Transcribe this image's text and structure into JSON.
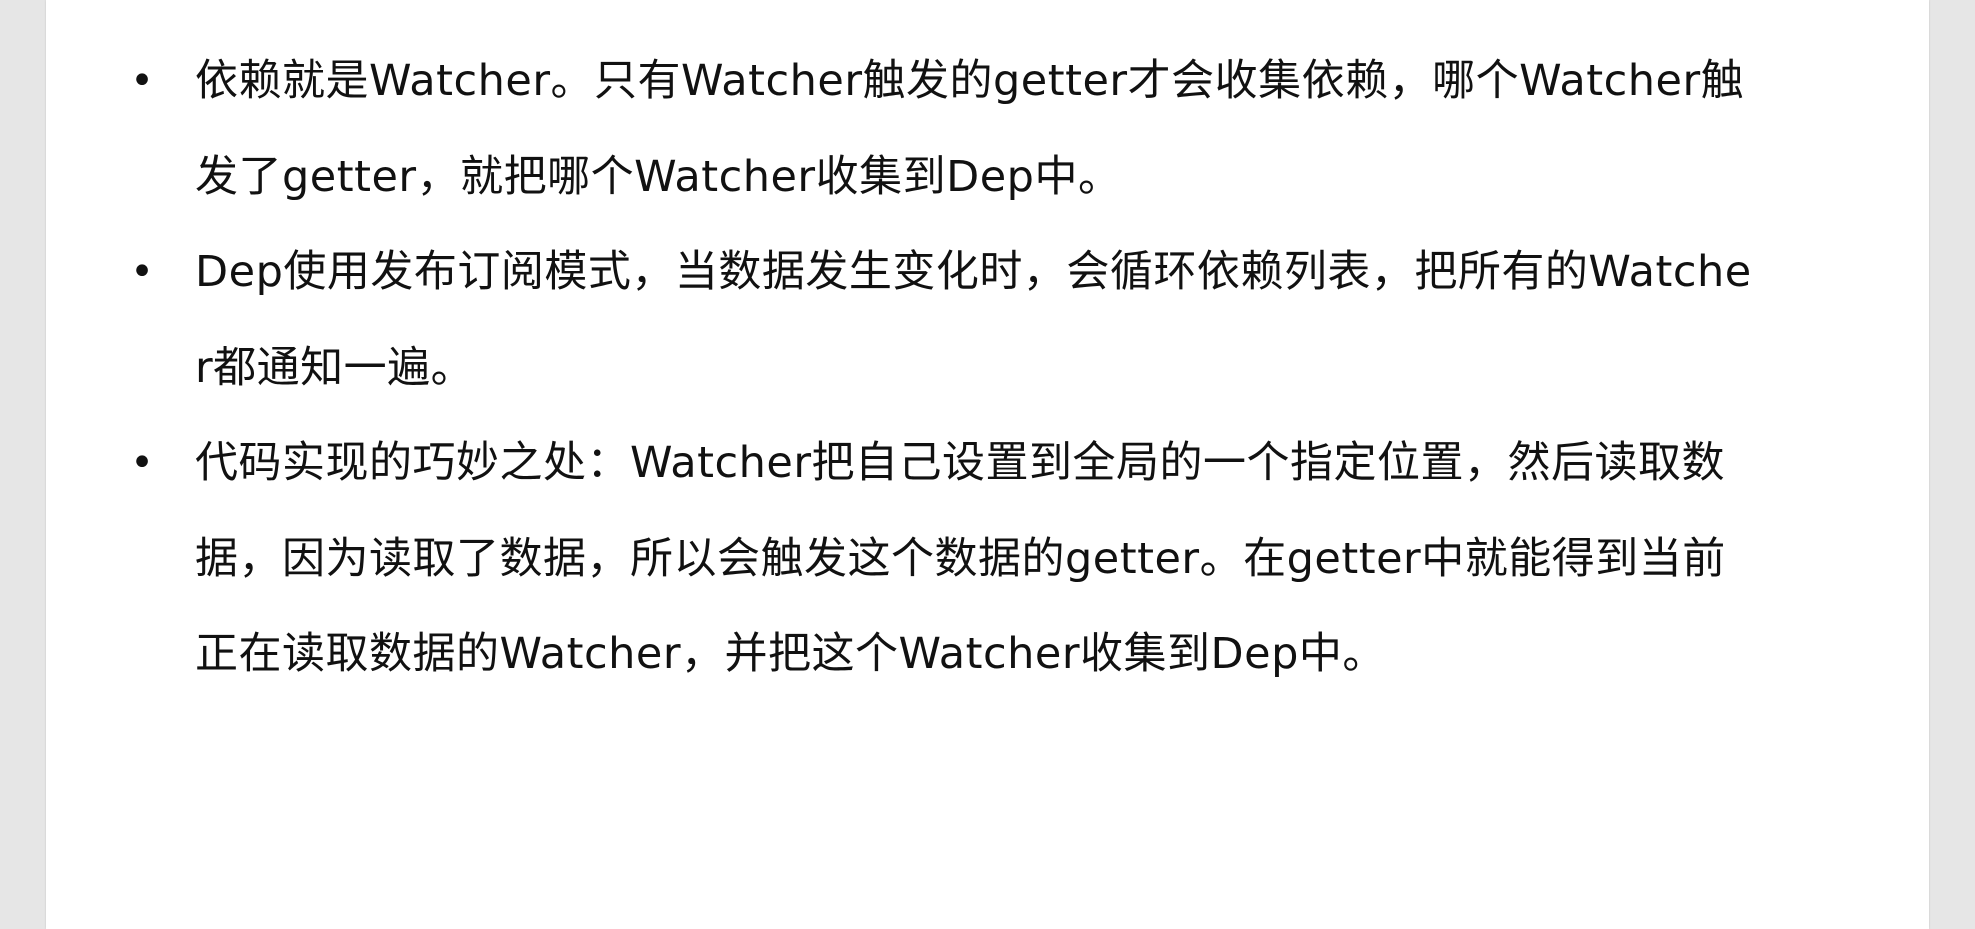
{
  "document": {
    "bullets": [
      {
        "marker": "•",
        "text": "依赖就是Watcher。只有Watcher触发的getter才会收集依赖，哪个Watcher触发了getter，就把哪个Watcher收集到Dep中。"
      },
      {
        "marker": "•",
        "text": "Dep使用发布订阅模式，当数据发生变化时，会循环依赖列表，把所有的Watcher都通知一遍。"
      },
      {
        "marker": "•",
        "text": "代码实现的巧妙之处：Watcher把自己设置到全局的一个指定位置，然后读取数据，因为读取了数据，所以会触发这个数据的getter。在getter中就能得到当前正在读取数据的Watcher，并把这个Watcher收集到Dep中。"
      }
    ]
  },
  "colors": {
    "page_background": "#ffffff",
    "frame_background": "#e6e6e6",
    "text": "#111111"
  }
}
